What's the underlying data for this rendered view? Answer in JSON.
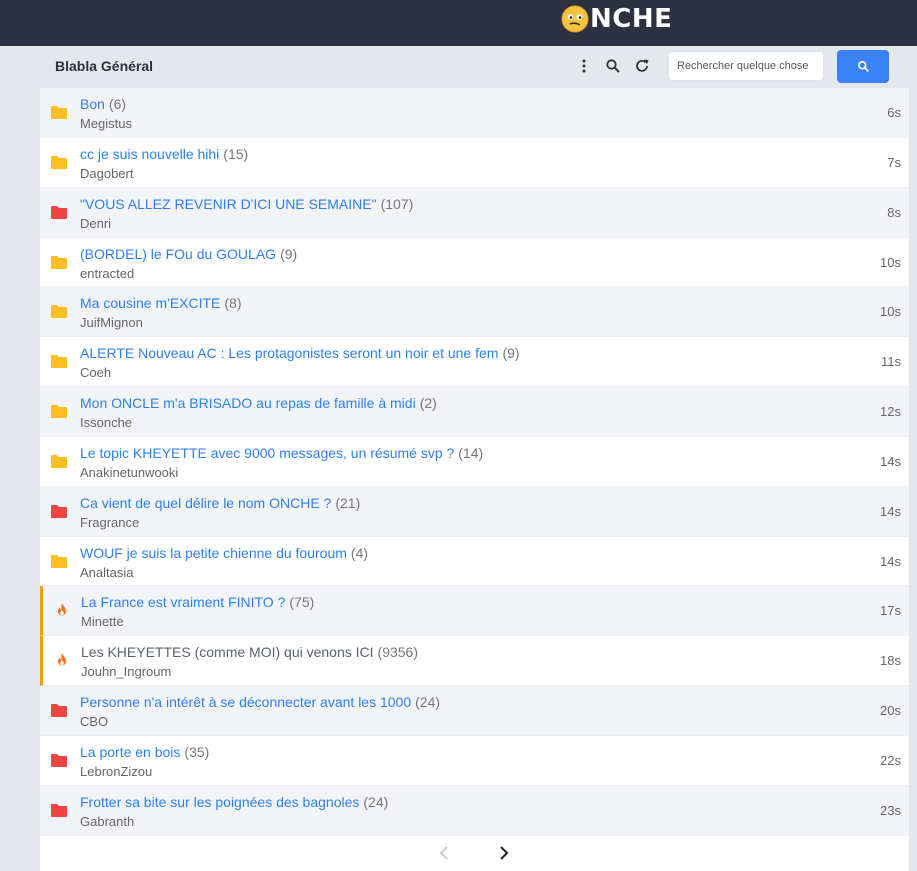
{
  "header": {
    "logo_text": "NCHE",
    "logo_icon": "smiley-face-icon"
  },
  "toolbar": {
    "forum_title": "Blabla Général",
    "search_placeholder": "Rechercher quelque chose"
  },
  "topics": [
    {
      "title": "Bon",
      "count": "(6)",
      "author": "Megistus",
      "time": "6s",
      "icon": "folder-yellow"
    },
    {
      "title": "cc je suis nouvelle hihi",
      "count": "(15)",
      "author": "Dagobert",
      "time": "7s",
      "icon": "folder-yellow"
    },
    {
      "title": "\"VOUS ALLEZ REVENIR D'ICI UNE SEMAINE\"",
      "count": "(107)",
      "author": "Denri",
      "time": "8s",
      "icon": "folder-red"
    },
    {
      "title": "(BORDEL) le FOu du GOULAG",
      "count": "(9)",
      "author": "entracted",
      "time": "10s",
      "icon": "folder-yellow"
    },
    {
      "title": "Ma cousine m'EXCITE",
      "count": "(8)",
      "author": "JuifMignon",
      "time": "10s",
      "icon": "folder-yellow"
    },
    {
      "title": "ALERTE Nouveau AC : Les protagonistes seront un noir et une fem",
      "count": "(9)",
      "author": "Coeh",
      "time": "11s",
      "icon": "folder-yellow"
    },
    {
      "title": "Mon ONCLE m'a BRISADO au repas de famille à midi",
      "count": "(2)",
      "author": "Issonche",
      "time": "12s",
      "icon": "folder-yellow"
    },
    {
      "title": "Le topic KHEYETTE avec 9000 messages, un résumé svp ?",
      "count": "(14)",
      "author": "Anakinetunwooki",
      "time": "14s",
      "icon": "folder-yellow"
    },
    {
      "title": "Ca vient de quel délire le nom ONCHE ?",
      "count": "(21)",
      "author": "Fragrance",
      "time": "14s",
      "icon": "folder-red"
    },
    {
      "title": "WOUF je suis la petite chienne du fouroum",
      "count": "(4)",
      "author": "Analtasia",
      "time": "14s",
      "icon": "folder-yellow"
    },
    {
      "title": "La France est vraiment FINITO ?",
      "count": "(75)",
      "author": "Minette",
      "time": "17s",
      "icon": "fire"
    },
    {
      "title": "Les KHEYETTES (comme MOI) qui venons ICI",
      "count": "(9356)",
      "author": "Jouhn_Ingroum",
      "time": "18s",
      "icon": "fire"
    },
    {
      "title": "Personne n'a intérêt à se déconnecter avant les 1000",
      "count": "(24)",
      "author": "CBO",
      "time": "20s",
      "icon": "folder-red"
    },
    {
      "title": "La porte en bois",
      "count": "(35)",
      "author": "LebronZizou",
      "time": "22s",
      "icon": "folder-red"
    },
    {
      "title": "Frotter sa bite sur les poignées des bagnoles",
      "count": "(24)",
      "author": "Gabranth",
      "time": "23s",
      "icon": "folder-red"
    }
  ],
  "colors": {
    "yellow": "#fbbf24",
    "red": "#ef4444",
    "fire": "#f97316",
    "link": "#2f80ed",
    "accent": "#3b82f6"
  }
}
